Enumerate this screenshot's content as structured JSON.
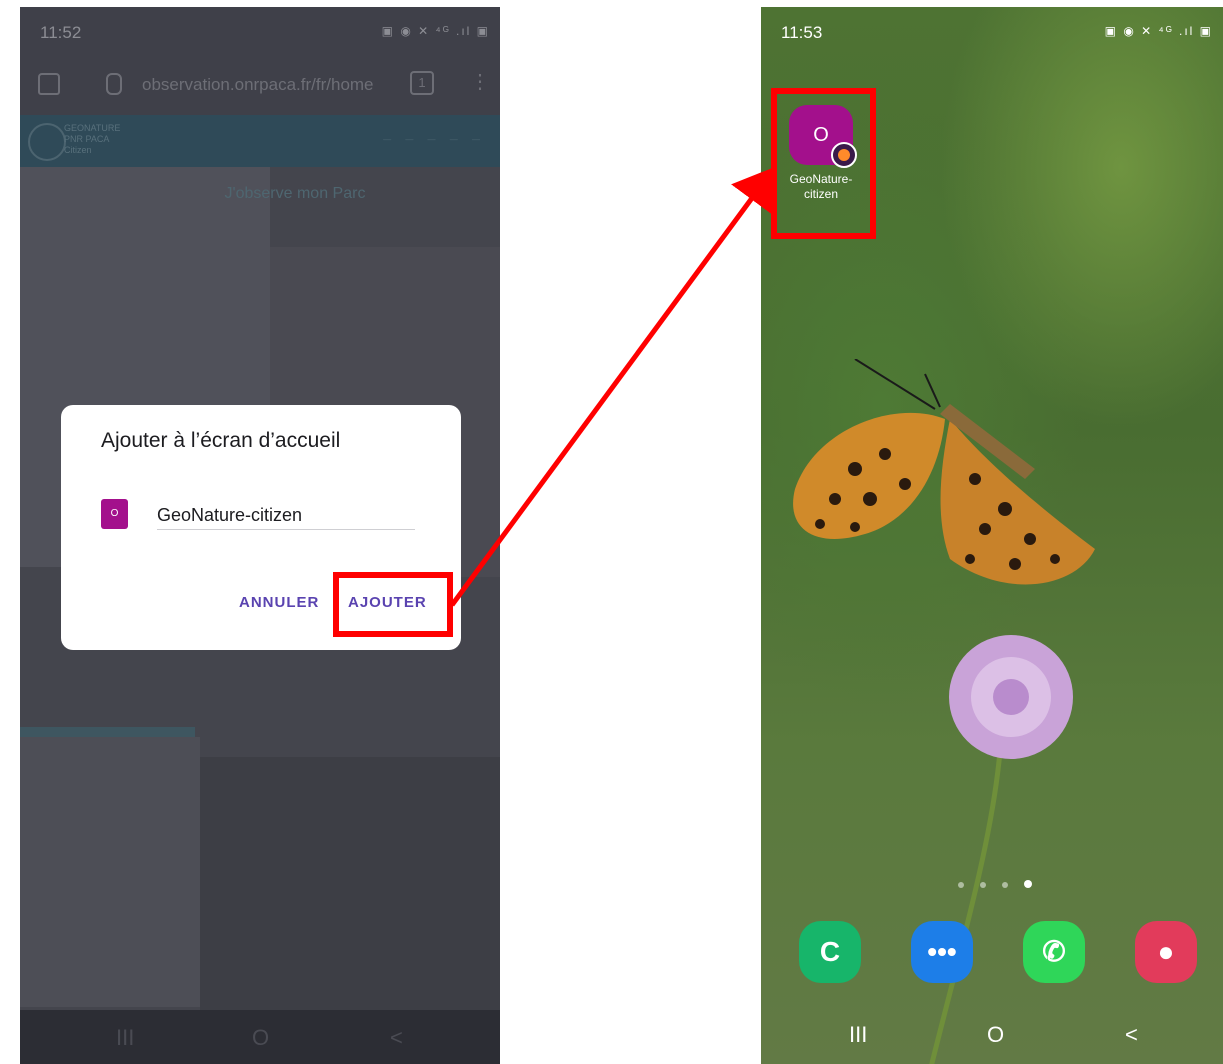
{
  "left_screen": {
    "status": {
      "time": "11:52",
      "icons": "▣ ◉ ✕ ⁴ᴳ .ıl ▣"
    },
    "browser": {
      "url": "observation.onrpaca.fr/fr/home",
      "tab_count": "1",
      "menu_glyph": "⋮"
    },
    "site": {
      "logo_text": "GEONATURE\nPNR PACA\nCitizen",
      "heading": "J'observe mon Parc"
    },
    "dialog": {
      "title": "Ajouter à l’écran d’accueil",
      "icon_letter": "O",
      "name_value": "GeoNature-citizen",
      "cancel_label": "ANNULER",
      "add_label": "AJOUTER"
    },
    "navbar": {
      "recents": "III",
      "home": "O",
      "back": "<"
    }
  },
  "right_screen": {
    "status": {
      "time": "11:53",
      "icons": "▣ ◉ ✕ ⁴ᴳ .ıl ▣"
    },
    "shortcut": {
      "icon_letter": "O",
      "label": "GeoNature-\ncitizen"
    },
    "page_dots": 4,
    "active_dot": 4,
    "dock": [
      {
        "name": "Téléphone",
        "glyph": "C",
        "color": "#17b56a"
      },
      {
        "name": "Messages",
        "glyph": "•••",
        "color": "#1d7ee8"
      },
      {
        "name": "WhatsApp",
        "glyph": "✆",
        "color": "#2fd659"
      },
      {
        "name": "Caméra",
        "glyph": "●",
        "color": "#e23b5b"
      }
    ],
    "navbar": {
      "recents": "III",
      "home": "O",
      "back": "<"
    }
  },
  "annotation": {
    "color": "#ff0000"
  }
}
